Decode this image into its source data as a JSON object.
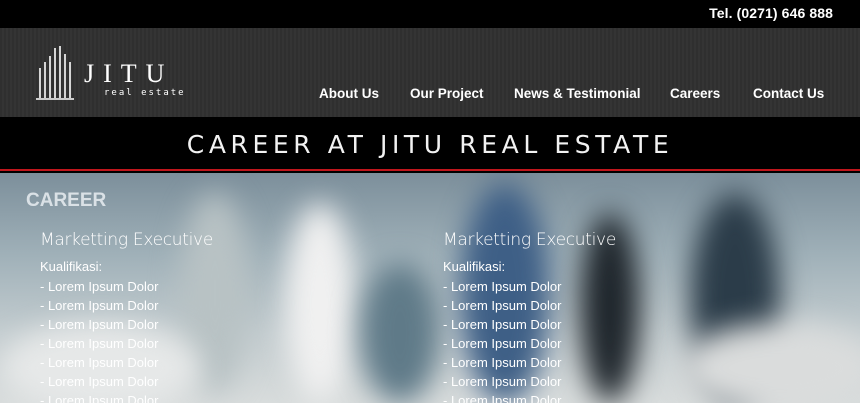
{
  "topbar": {
    "phone": "Tel. (0271) 646 888"
  },
  "logo": {
    "name": "JITU",
    "tagline": "real estate"
  },
  "nav": {
    "items": [
      "About Us",
      "Our Project",
      "News & Testimonial",
      "Careers",
      "Contact Us"
    ]
  },
  "page": {
    "title": "CAREER AT JITU REAL ESTATE"
  },
  "career": {
    "heading": "CAREER",
    "columns": [
      {
        "job": "Marketting Executive",
        "qual_label": "Kualifikasi:",
        "items": [
          "- Lorem Ipsum Dolor",
          "- Lorem Ipsum Dolor",
          "- Lorem Ipsum Dolor",
          "- Lorem Ipsum Dolor",
          "- Lorem Ipsum Dolor",
          "- Lorem Ipsum Dolor",
          "- Lorem Ipsum Dolor"
        ]
      },
      {
        "job": "Marketting Executive",
        "qual_label": "Kualifikasi:",
        "items": [
          "- Lorem Ipsum Dolor",
          "- Lorem Ipsum Dolor",
          "- Lorem Ipsum Dolor",
          "- Lorem Ipsum Dolor",
          "- Lorem Ipsum Dolor",
          "- Lorem Ipsum Dolor",
          "- Lorem Ipsum Dolor"
        ]
      }
    ]
  },
  "colors": {
    "accent_line": "#c0161c",
    "header_bg": "#333333",
    "topbar_bg": "#000000"
  }
}
